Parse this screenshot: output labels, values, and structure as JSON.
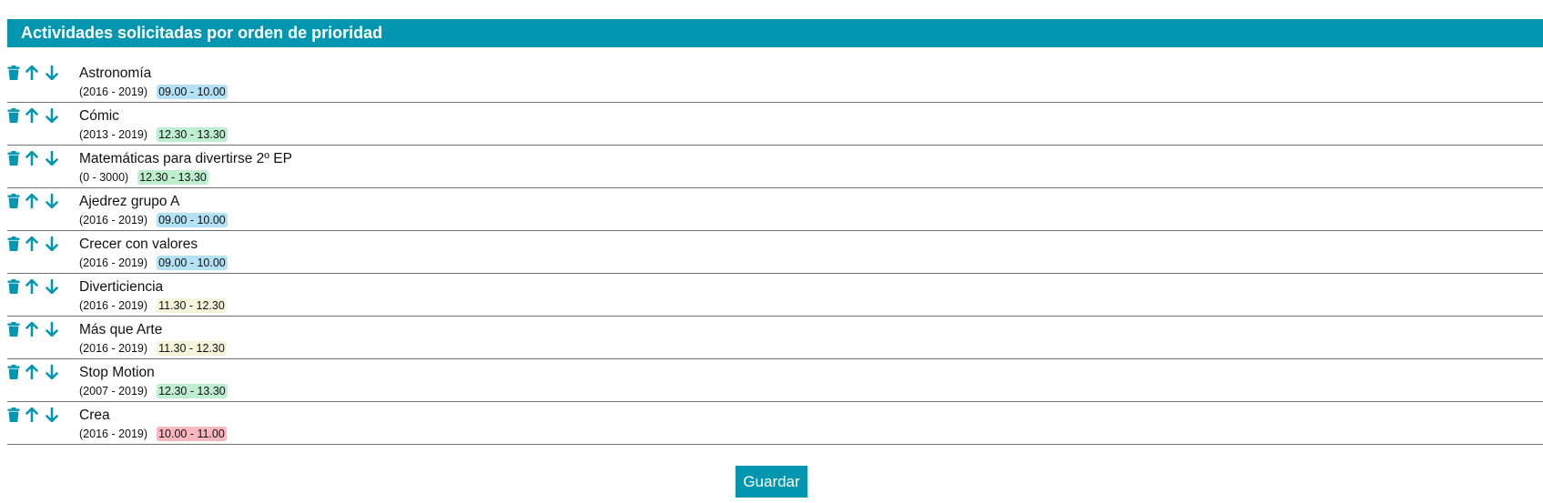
{
  "header": {
    "title": "Actividades solicitadas por orden de prioridad"
  },
  "icons": {
    "delete": "trash-icon",
    "up": "arrow-up-icon",
    "down": "arrow-down-icon"
  },
  "colors": {
    "accent": "#0396b1",
    "slot_0900": "#b3e2f5",
    "slot_1000": "#f9b7c0",
    "slot_1130": "#f6f5db",
    "slot_1230": "#bdeed0"
  },
  "activities": [
    {
      "name": "Astronomía",
      "years": "(2016 - 2019)",
      "time": "09.00 - 10.00",
      "color": "#b3e2f5"
    },
    {
      "name": "Cómic",
      "years": "(2013 - 2019)",
      "time": "12.30 - 13.30",
      "color": "#bdeed0"
    },
    {
      "name": "Matemáticas para divertirse 2º EP",
      "years": "(0 - 3000)",
      "time": "12.30 - 13.30",
      "color": "#bdeed0"
    },
    {
      "name": "Ajedrez grupo A",
      "years": "(2016 - 2019)",
      "time": "09.00 - 10.00",
      "color": "#b3e2f5"
    },
    {
      "name": "Crecer con valores",
      "years": "(2016 - 2019)",
      "time": "09.00 - 10.00",
      "color": "#b3e2f5"
    },
    {
      "name": "Diverticiencia",
      "years": "(2016 - 2019)",
      "time": "11.30 - 12.30",
      "color": "#f6f5db"
    },
    {
      "name": "Más que Arte",
      "years": "(2016 - 2019)",
      "time": "11.30 - 12.30",
      "color": "#f6f5db"
    },
    {
      "name": "Stop Motion",
      "years": "(2007 - 2019)",
      "time": "12.30 - 13.30",
      "color": "#bdeed0"
    },
    {
      "name": "Crea",
      "years": "(2016 - 2019)",
      "time": "10.00 - 11.00",
      "color": "#f9b7c0"
    }
  ],
  "footer": {
    "save_label": "Guardar"
  }
}
